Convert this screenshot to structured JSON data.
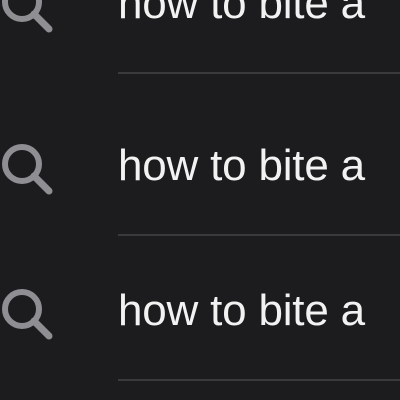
{
  "suggestions": {
    "items": [
      {
        "label": "how to bite a",
        "icon": "search-icon"
      },
      {
        "label": "how to bite a",
        "icon": "search-icon"
      },
      {
        "label": "how to bite a",
        "icon": "search-icon"
      }
    ]
  },
  "colors": {
    "background": "#1c1c1e",
    "text": "#f2f2f2",
    "icon": "#8e8e93",
    "divider": "#3a3a3c"
  }
}
